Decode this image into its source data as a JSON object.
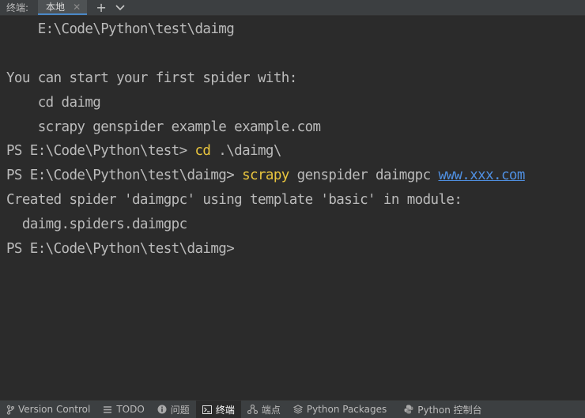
{
  "tabbar": {
    "tool_window_title": "终端:",
    "tabs": [
      {
        "label": "本地",
        "close": "✕"
      }
    ],
    "add_label": "+"
  },
  "terminal": {
    "lines": [
      "    E:\\Code\\Python\\test\\daimg",
      "",
      "You can start your first spider with:",
      "    cd daimg",
      "    scrapy genspider example example.com",
      "",
      "PS E:\\Code\\Python\\test\\daimg> ",
      "Created spider 'daimgpc' using template 'basic' in module:",
      "  daimg.spiders.daimgpc",
      "PS E:\\Code\\Python\\test\\daimg>"
    ],
    "cmd1": {
      "prompt": "PS E:\\Code\\Python\\test> ",
      "command": "cd",
      "args": " .\\daimg\\"
    },
    "cmd2": {
      "prompt": "PS E:\\Code\\Python\\test\\daimg> ",
      "command": "scrapy",
      "args": " genspider daimgpc ",
      "url": "www.xxx.com"
    },
    "colors": {
      "background": "#2b2b2b",
      "text": "#bbbbbb",
      "command": "#e9c53e",
      "link": "#4f8fe0"
    }
  },
  "statusbar": {
    "items": [
      {
        "label": "Version Control",
        "icon": "branch-icon"
      },
      {
        "label": "TODO",
        "icon": "list-icon"
      },
      {
        "label": "问题",
        "icon": "info-icon"
      },
      {
        "label": "终端",
        "icon": "terminal-icon",
        "active": true
      },
      {
        "label": "端点",
        "icon": "endpoints-icon"
      },
      {
        "label": "Python Packages",
        "icon": "layers-icon"
      },
      {
        "label": "Python 控制台",
        "icon": "python-icon"
      }
    ]
  }
}
